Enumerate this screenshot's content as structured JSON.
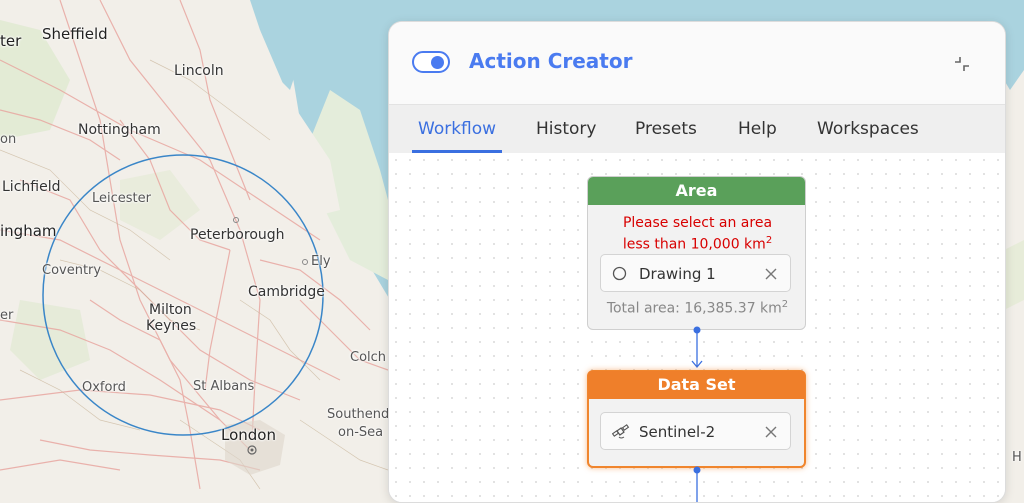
{
  "map": {
    "cities": [
      {
        "name": "Sheffield"
      },
      {
        "name": "Lincoln"
      },
      {
        "name": "Nottingham"
      },
      {
        "name": "Lichfield"
      },
      {
        "name": "Leicester"
      },
      {
        "name": "ingham"
      },
      {
        "name": "Peterborough"
      },
      {
        "name": "Coventry"
      },
      {
        "name": "Ely"
      },
      {
        "name": "Cambridge"
      },
      {
        "name": "Milton"
      },
      {
        "name": "Keynes"
      },
      {
        "name": "Oxford"
      },
      {
        "name": "St Albans"
      },
      {
        "name": "London"
      },
      {
        "name": "Colch"
      },
      {
        "name": "Southend-"
      },
      {
        "name": "on-Sea"
      },
      {
        "name": "ter"
      },
      {
        "name": "on"
      },
      {
        "name": "er"
      },
      {
        "name": "H"
      }
    ]
  },
  "panel": {
    "title": "Action Creator",
    "toggle_on": true,
    "accent_color": "#4a7bf0",
    "tabs": [
      {
        "label": "Workflow",
        "active": true
      },
      {
        "label": "History",
        "active": false
      },
      {
        "label": "Presets",
        "active": false
      },
      {
        "label": "Help",
        "active": false
      },
      {
        "label": "Workspaces",
        "active": false
      }
    ]
  },
  "workflow": {
    "area_node": {
      "title": "Area",
      "header_color": "#5aa05a",
      "error_line1": "Please select an area",
      "error_line2": "less than 10,000 km",
      "error_sup": "2",
      "drawing_label": "Drawing 1",
      "drawing_icon": "circle-icon",
      "total_label": "Total area: 16,385.37 km",
      "total_sup": "2"
    },
    "dataset_node": {
      "title": "Data Set",
      "header_color": "#ef7f2a",
      "dataset_label": "Sentinel-2",
      "dataset_icon": "satellite-icon"
    }
  }
}
